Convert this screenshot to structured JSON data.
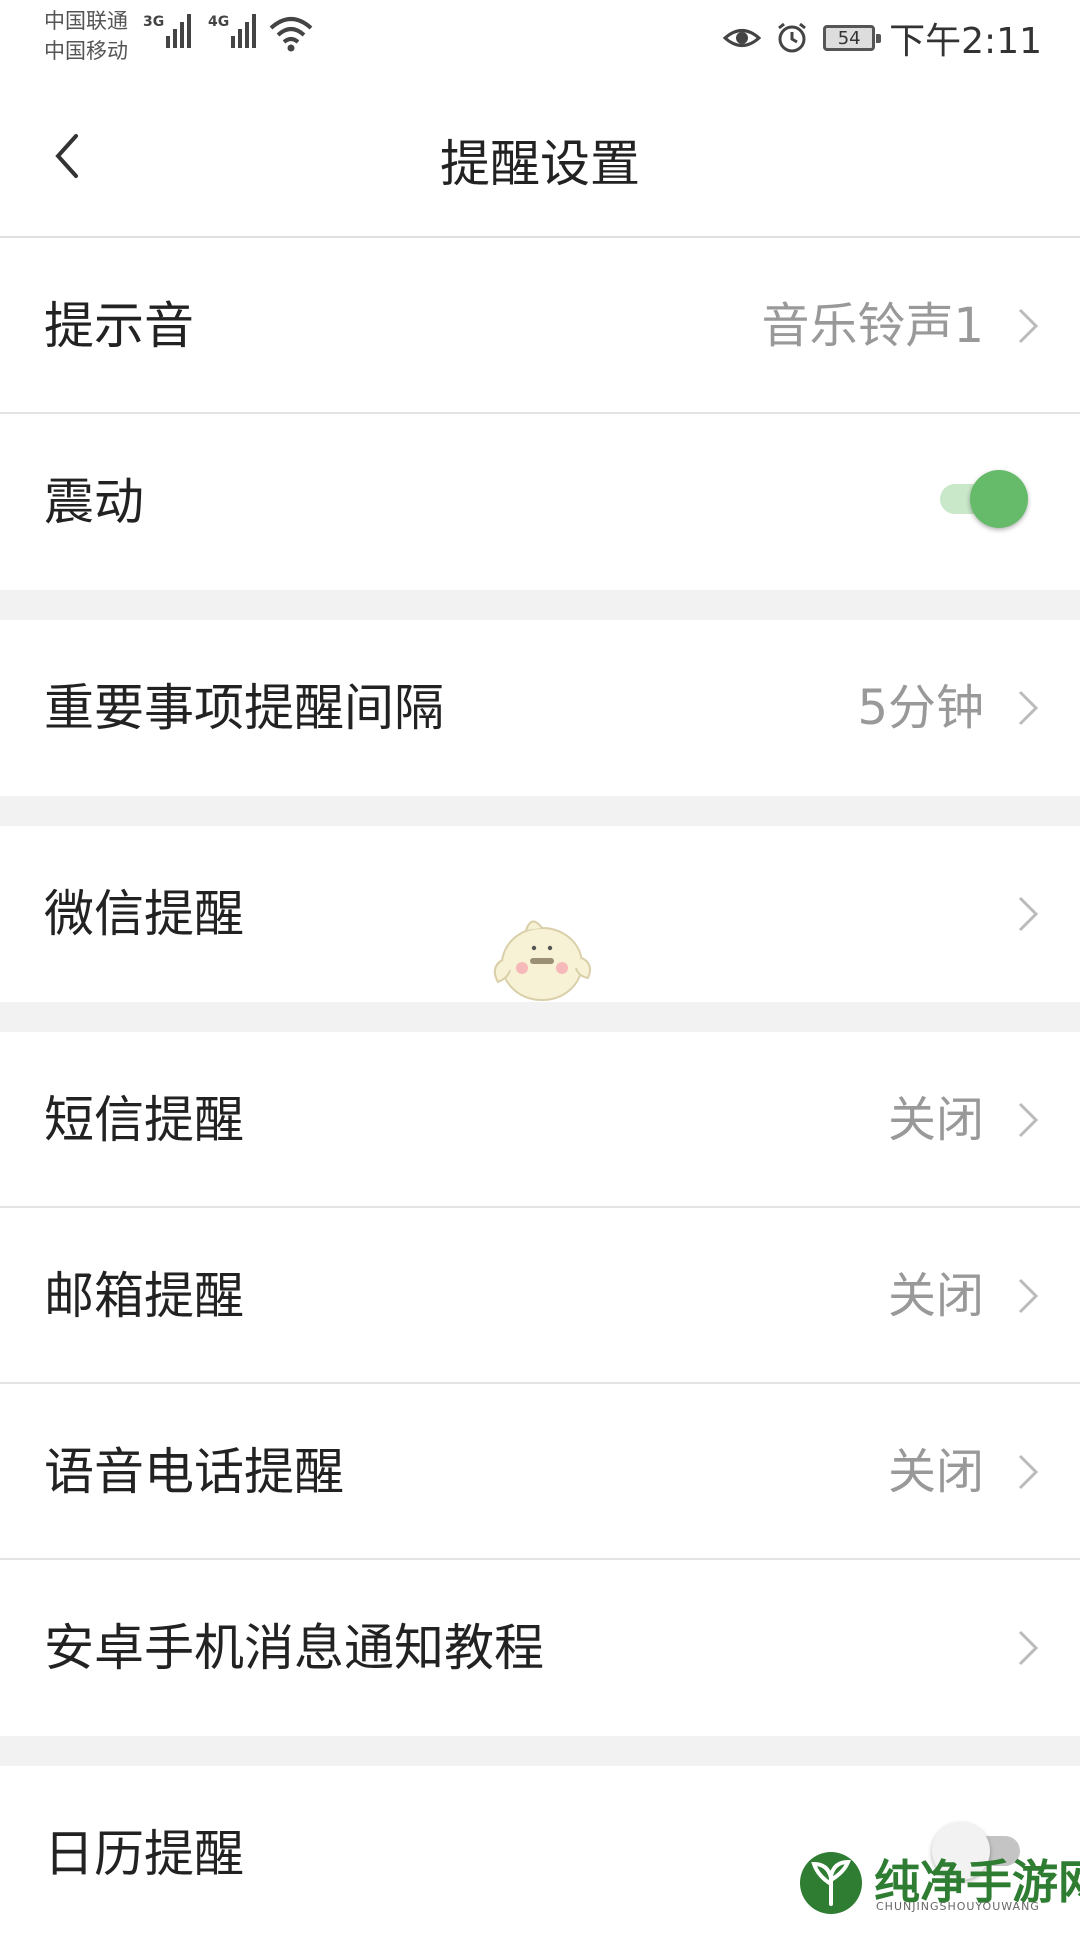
{
  "status_bar": {
    "carrier_1": "中国联通",
    "carrier_2": "中国移动",
    "network_1": "3G",
    "network_2": "4G",
    "battery": "54",
    "time": "下午2:11",
    "icons": [
      "signal-icon",
      "wifi-icon",
      "eye-icon",
      "alarm-icon",
      "battery-icon"
    ]
  },
  "header": {
    "title": "提醒设置",
    "back_icon": "chevron-left-icon"
  },
  "settings": {
    "sound": {
      "label": "提示音",
      "value": "音乐铃声1"
    },
    "vibrate": {
      "label": "震动",
      "enabled": true
    },
    "important_interval": {
      "label": "重要事项提醒间隔",
      "value": "5分钟"
    },
    "wechat": {
      "label": "微信提醒"
    },
    "sms": {
      "label": "短信提醒",
      "value": "关闭"
    },
    "email": {
      "label": "邮箱提醒",
      "value": "关闭"
    },
    "voice_call": {
      "label": "语音电话提醒",
      "value": "关闭"
    },
    "android_tutorial": {
      "label": "安卓手机消息通知教程"
    },
    "calendar": {
      "label": "日历提醒",
      "enabled": false
    }
  },
  "watermark": {
    "text": "纯净手游网",
    "subtext": "CHUNJINGSHOUYOUWANG"
  },
  "colors": {
    "accent_green": "#66bb6a",
    "value_gray": "#999999",
    "divider": "#e4e4e4",
    "section_gap": "#f2f2f2"
  }
}
